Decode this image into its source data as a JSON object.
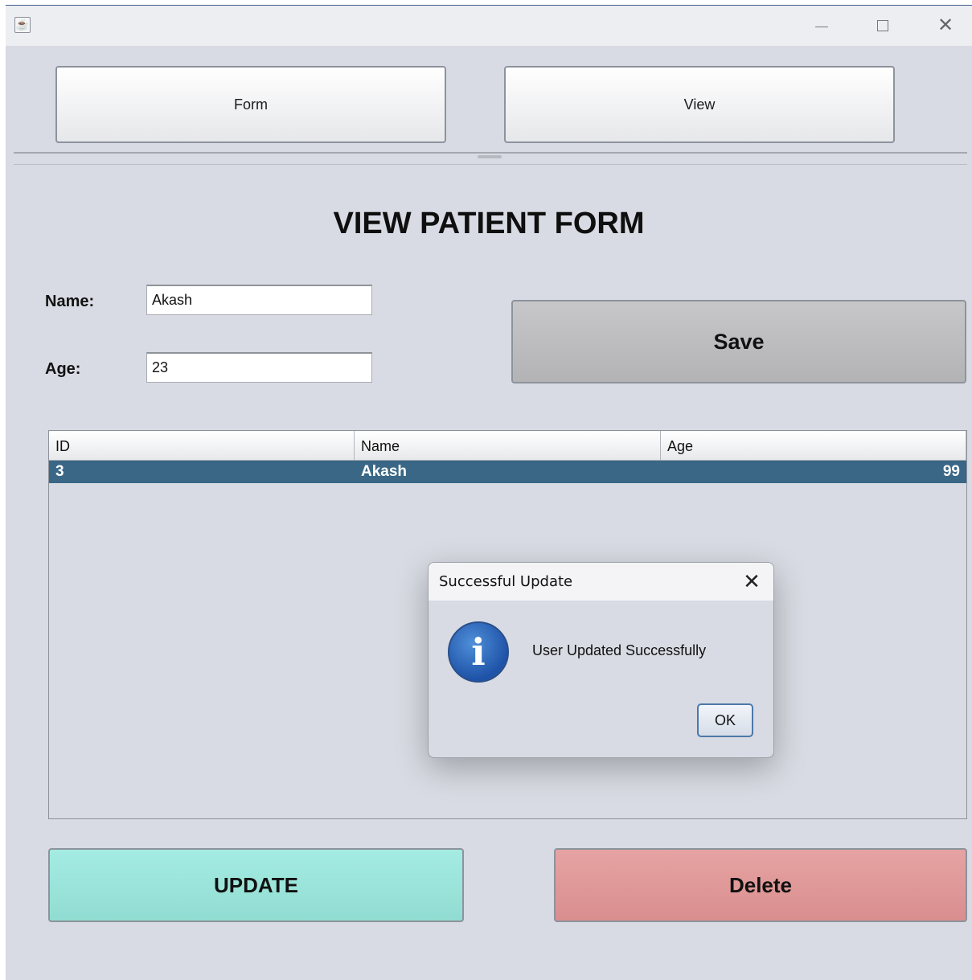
{
  "window": {
    "icon": "java-app-icon",
    "controls": {
      "minimize": "—",
      "maximize": "☐",
      "close": "✕"
    }
  },
  "nav": {
    "form_label": "Form",
    "view_label": "View"
  },
  "page": {
    "title": "VIEW PATIENT FORM"
  },
  "form": {
    "name_label": "Name:",
    "name_value": "Akash",
    "age_label": "Age:",
    "age_value": "23",
    "save_label": "Save"
  },
  "table": {
    "columns": [
      "ID",
      "Name",
      "Age"
    ],
    "rows": [
      {
        "id": "3",
        "name": "Akash",
        "age": "99",
        "selected": true
      }
    ]
  },
  "actions": {
    "update_label": "UPDATE",
    "delete_label": "Delete"
  },
  "dialog": {
    "title": "Successful Update",
    "close": "✕",
    "icon": "info-icon",
    "icon_glyph": "i",
    "message": "User Updated Successfully",
    "ok_label": "OK"
  },
  "colors": {
    "background": "#d8dbe3",
    "selected_row": "#3a6785",
    "update_button": "#9be4da",
    "delete_button": "#df9898",
    "save_button": "#bdbdbf"
  }
}
